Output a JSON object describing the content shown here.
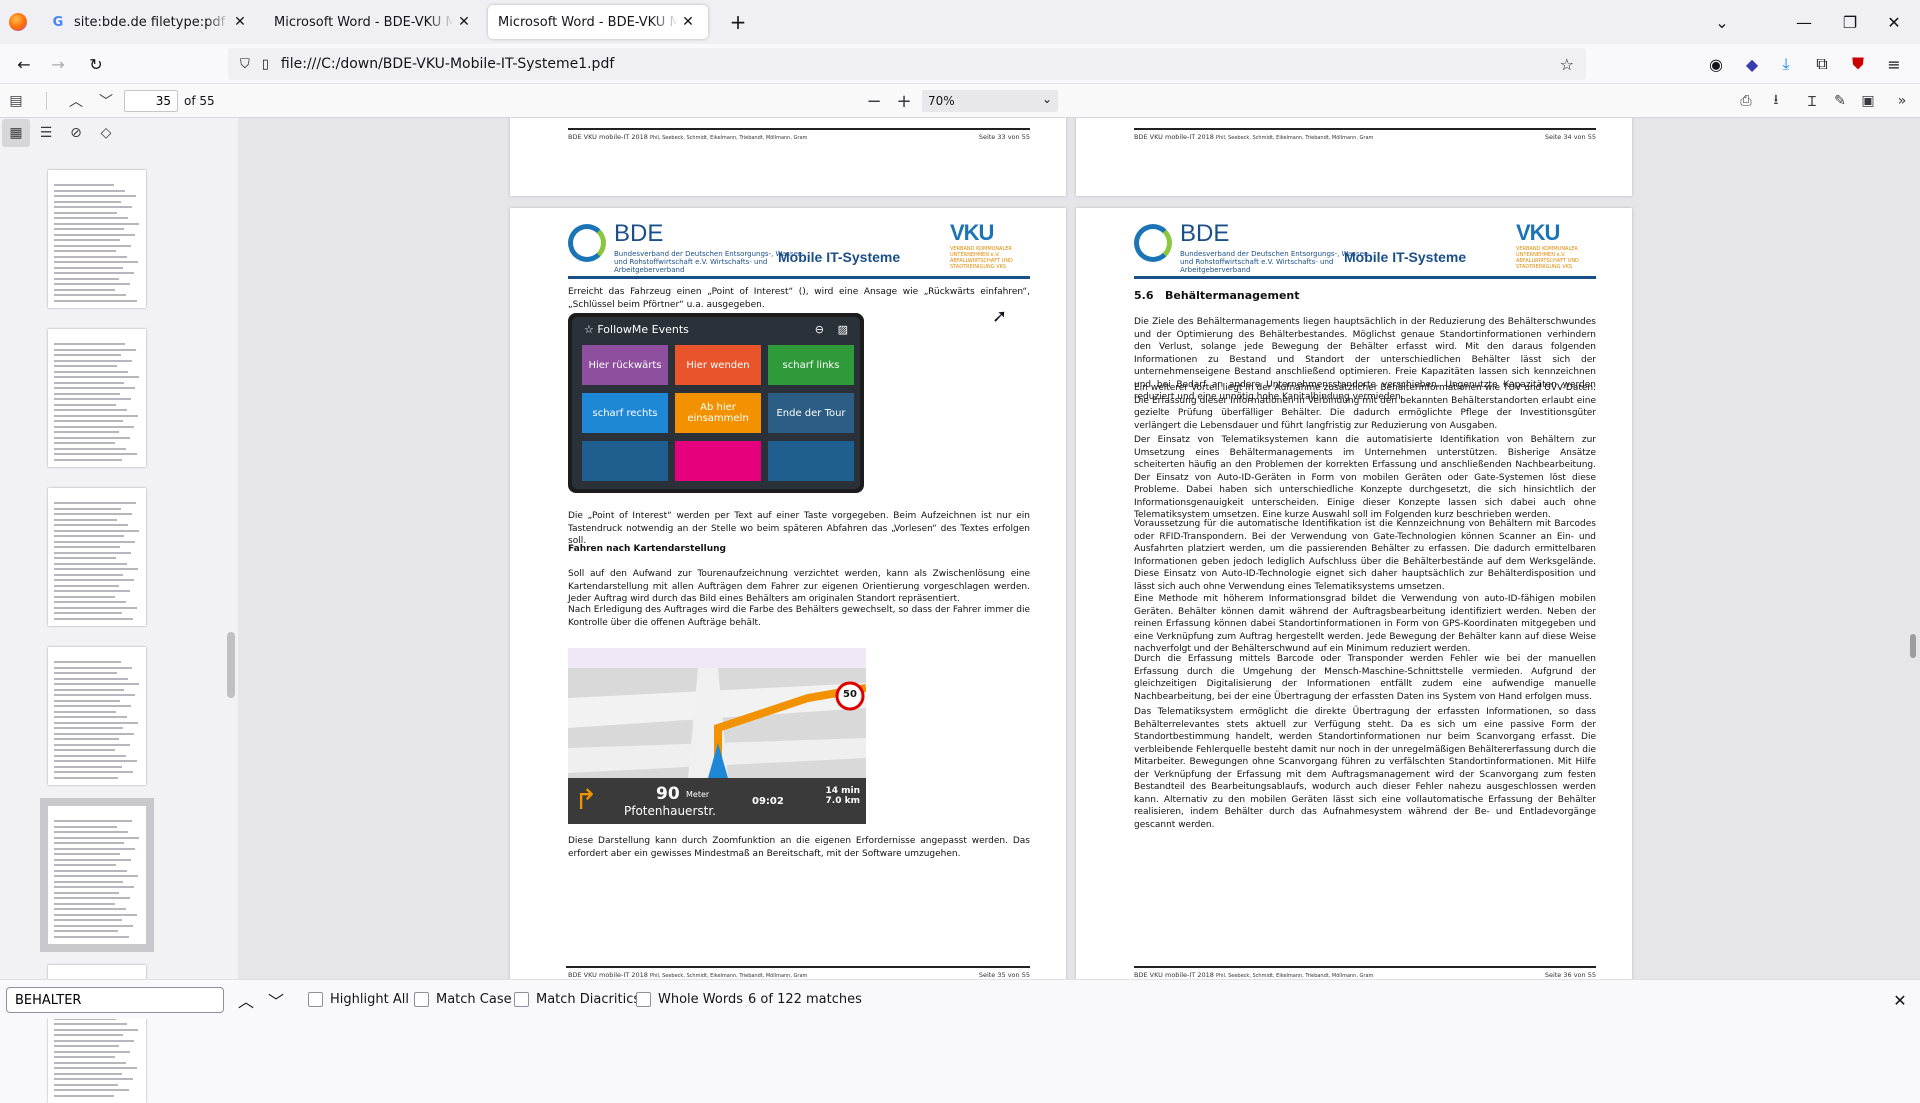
{
  "tabs": [
    {
      "icon": "google-icon",
      "label": "site:bde.de filetype:pdf schnittstelle"
    },
    {
      "icon": "",
      "label": "Microsoft Word - BDE-VKU Mobile-IT"
    },
    {
      "icon": "",
      "label": "Microsoft Word - BDE-VKU Mobile-IT"
    }
  ],
  "address": {
    "url": "file:///C:/down/BDE-VKU-Mobile-IT-Systeme1.pdf"
  },
  "pdf_toolbar": {
    "page": "35",
    "of": "of 55",
    "zoom": "70%"
  },
  "pages": {
    "p33_footer": {
      "left": "BDE VKU mobile-IT 2018",
      "authors": "Phil, Seebeck, Schmidt, Eikelmann, Triebandt, Möllmann, Gram",
      "right": "Seite 33 von 55"
    },
    "p34_footer": {
      "left": "BDE VKU mobile-IT 2018",
      "authors": "Phil, Seebeck, Schmidt, Eikelmann, Triebandt, Möllmann, Gram",
      "right": "Seite 34 von 55"
    },
    "header": {
      "bde": "BDE",
      "bde_sub": "Bundesverband der Deutschen Entsorgungs-, Wasser- und Rohstoffwirtschaft e.V. Wirtschafts- und Arbeitgeberverband",
      "title": "Mobile IT-Systeme",
      "vku": "VKU",
      "vku_sub": "VERBAND KOMMUNALER UNTERNEHMEN e.V. ABFALLWIRTSCHAFT UND STADTREINIGUNG VKS"
    },
    "p35": {
      "para1": "Erreicht das Fahrzeug einen „Point of Interest“ (), wird eine Ansage wie „Rückwärts einfahren“, „Schlüssel beim Pförtner“ u.a. ausgegeben.",
      "followme_title": "FollowMe Events",
      "tiles": [
        "Hier rückwärts",
        "Hier wenden",
        "scharf links",
        "scharf rechts",
        "Ab hier einsammeln",
        "Ende der Tour",
        "",
        "",
        ""
      ],
      "tile_colors": [
        "#8e4f9e",
        "#e9542a",
        "#2f9a3a",
        "#1e88d6",
        "#f39200",
        "#2b5d85",
        "#1f5f8f",
        "#e6007e",
        "#1f5f8f"
      ],
      "para2": "Die „Point of Interest“ werden per Text auf einer Taste vorgegeben. Beim Aufzeichnen ist nur ein Tastendruck notwendig an der Stelle wo beim späteren Abfahren das „Vorlesen“ des Textes erfolgen soll.",
      "heading": "Fahren nach Kartendarstellung",
      "para3": "Soll auf den Aufwand zur Tourenaufzeichnung verzichtet werden, kann als Zwischenlösung eine Kartendarstellung mit allen Aufträgen dem Fahrer zur eigenen Orientierung vorgeschlagen werden. Jeder Auftrag wird durch das Bild eines Behälters am originalen Standort repräsentiert.",
      "para4": "Nach Erledigung des Auftrages wird die Farbe des Behälters gewechselt, so dass der Fahrer immer die Kontrolle über die offenen Aufträge behält.",
      "nav": {
        "speed": "50",
        "dist": "90",
        "unit": "Meter",
        "street": "Pfotenhauerstr.",
        "time": "09:02",
        "eta": "14 min",
        "km": "7.0 km"
      },
      "para5": "Diese Darstellung kann durch Zoomfunktion an die eigenen Erfordernisse angepasst werden. Das erfordert aber ein gewisses Mindestmaß an Bereitschaft, mit der Software umzugehen.",
      "footer": {
        "left": "BDE VKU mobile-IT 2018",
        "authors": "Phil, Seebeck, Schmidt, Eikelmann, Triebandt, Möllmann, Gram",
        "right": "Seite 35 von 55"
      }
    },
    "p36": {
      "section": "5.6",
      "section_title": "Behältermanagement",
      "paras": [
        "Die Ziele des Behältermanagements liegen hauptsächlich in der Reduzierung des Behälterschwundes und der Optimierung des Behälterbestandes. Möglichst genaue Standortinformationen verhindern den Verlust, solange jede Bewegung der Behälter erfasst wird. Mit den daraus folgenden Informationen zu Bestand und Standort der unterschiedlichen Behälter lässt sich der unternehmenseigene Bestand anschließend optimieren. Freie Kapazitäten lassen sich kennzeichnen und bei Bedarf an andere Unternehmensstandorte verschieben. Ungenutzte Kapazitäten werden reduziert und eine unnötig hohe Kapitalbindung vermieden.",
        "Ein weiterer Vorteil liegt in der Aufnahme zusätzlicher Behälterinformationen wie TÜV und UVV-Daten. Die Erfassung dieser Informationen in Verbindung mit den bekannten Behälterstandorten erlaubt eine gezielte Prüfung überfälliger Behälter. Die dadurch ermöglichte Pflege der Investitionsgüter verlängert die Lebensdauer und führt langfristig zur Reduzierung von Ausgaben.",
        "Der Einsatz von Telematiksystemen kann die automatisierte Identifikation von Behältern zur Umsetzung eines Behältermanagements im Unternehmen unterstützen. Bisherige Ansätze scheiterten häufig an den Problemen der korrekten Erfassung und anschließenden Nachbearbeitung. Der Einsatz von Auto-ID-Geräten in Form von mobilen Geräten oder Gate-Systemen löst diese Probleme. Dabei haben sich unterschiedliche Konzepte durchgesetzt, die sich hinsichtlich der Informationsgenauigkeit unterscheiden. Einige dieser Konzepte lassen sich dabei auch ohne Telematiksystem umsetzen. Eine kurze Auswahl soll im Folgenden kurz beschrieben werden.",
        "Voraussetzung für die automatische Identifikation ist die Kennzeichnung von Behältern mit Barcodes oder RFID-Transpondern. Bei der Verwendung von Gate-Technologien können Scanner an Ein- und Ausfahrten platziert werden, um die passierenden Behälter zu erfassen. Die dadurch ermittelbaren Informationen geben jedoch lediglich Aufschluss über die Behälterbestände auf dem Werksgelände. Diese Einsatz von Auto-ID-Technologie eignet sich daher hauptsächlich zur Behälterdisposition und lässt sich auch ohne Verwendung eines Telematiksystems umsetzen.",
        "Eine Methode mit höherem Informationsgrad bildet die Verwendung von auto-ID-fähigen mobilen Geräten. Behälter können damit während der Auftragsbearbeitung identifiziert werden. Neben der reinen Erfassung können dabei Standortinformationen in Form von GPS-Koordinaten mitgegeben und eine Verknüpfung zum Auftrag hergestellt werden. Jede Bewegung der Behälter kann auf diese Weise nachverfolgt und der Behälterschwund auf ein Minimum reduziert werden.",
        "Durch die Erfassung mittels Barcode oder Transponder werden Fehler wie bei der manuellen Erfassung durch die Umgehung der Mensch-Maschine-Schnittstelle vermieden. Aufgrund der gleichzeitigen Digitalisierung der Informationen entfällt zudem eine aufwendige manuelle Nachbearbeitung, bei der eine Übertragung der erfassten Daten ins System von Hand erfolgen muss.",
        "Das Telematiksystem ermöglicht die direkte Übertragung der erfassten Informationen, so dass Behälterrelevantes stets aktuell zur Verfügung steht. Da es sich um eine passive Form der Standortbestimmung handelt, werden Standortinformationen nur beim Scanvorgang erfasst. Die verbleibende Fehlerquelle besteht damit nur noch in der unregelmäßigen Behältererfassung durch die Mitarbeiter. Bewegungen ohne Scanvorgang führen zu verfälschten Standortinformationen. Mit Hilfe der Verknüpfung der Erfassung mit dem Auftragsmanagement wird der Scanvorgang zum festen Bestandteil des Bearbeitungsablaufs, wodurch auch dieser Fehler nahezu ausgeschlossen werden kann. Alternativ zu den mobilen Geräten lässt sich eine vollautomatische Erfassung der Behälter realisieren, indem Behälter durch das Aufnahmesystem während der Be- und Entladevorgänge gescannt werden."
      ],
      "footer": {
        "left": "BDE VKU mobile-IT 2018",
        "authors": "Phil, Seebeck, Schmidt, Eikelmann, Triebandt, Möllmann, Gram",
        "right": "Seite 36 von 55"
      }
    }
  },
  "findbar": {
    "query": "BEHÄLTER",
    "highlight_all": "Highlight All",
    "match_case": "Match Case",
    "match_diacritics": "Match Diacritics",
    "whole_words": "Whole Words",
    "status": "6 of 122 matches"
  }
}
